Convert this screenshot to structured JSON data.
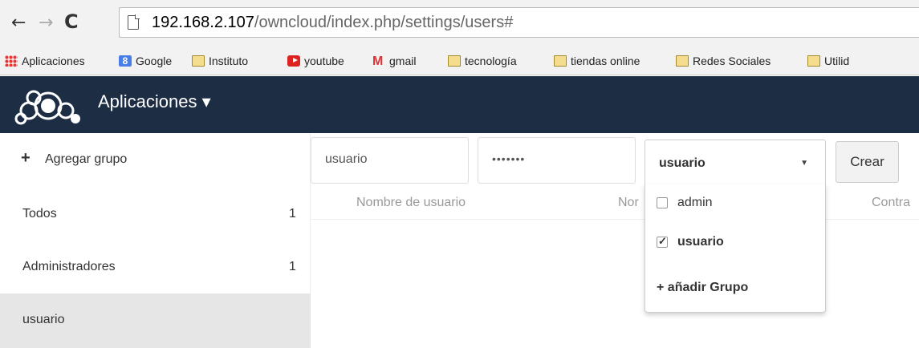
{
  "browser": {
    "url_host": "192.168.2.107",
    "url_path": "/owncloud/index.php/settings/users#"
  },
  "bookmarks": [
    {
      "label": "Aplicaciones",
      "icon": "apps-grid-icon"
    },
    {
      "label": "Google",
      "icon": "google-icon"
    },
    {
      "label": "Instituto",
      "icon": "folder-icon"
    },
    {
      "label": "youtube",
      "icon": "youtube-icon"
    },
    {
      "label": "gmail",
      "icon": "gmail-icon"
    },
    {
      "label": "tecnología",
      "icon": "folder-icon"
    },
    {
      "label": "tiendas online",
      "icon": "folder-icon"
    },
    {
      "label": "Redes Sociales",
      "icon": "folder-icon"
    },
    {
      "label": "Utilid",
      "icon": "folder-icon"
    }
  ],
  "header": {
    "apps_label": "Aplicaciones ▾",
    "brand_color": "#1d2d44"
  },
  "sidebar": {
    "add_group_label": "Agregar grupo",
    "items": [
      {
        "label": "Todos",
        "count": "1"
      },
      {
        "label": "Administradores",
        "count": "1"
      },
      {
        "label": "usuario",
        "count": ""
      }
    ]
  },
  "form": {
    "username_value": "usuario",
    "password_value": "•••••••",
    "group_select_value": "usuario",
    "create_button": "Crear"
  },
  "table": {
    "headers": [
      "Nombre de usuario",
      "Nor",
      "Contra"
    ]
  },
  "dropdown": {
    "options": [
      {
        "label": "admin",
        "checked": false
      },
      {
        "label": "usuario",
        "checked": true
      }
    ],
    "add_group_label": "+ añadir Grupo"
  }
}
